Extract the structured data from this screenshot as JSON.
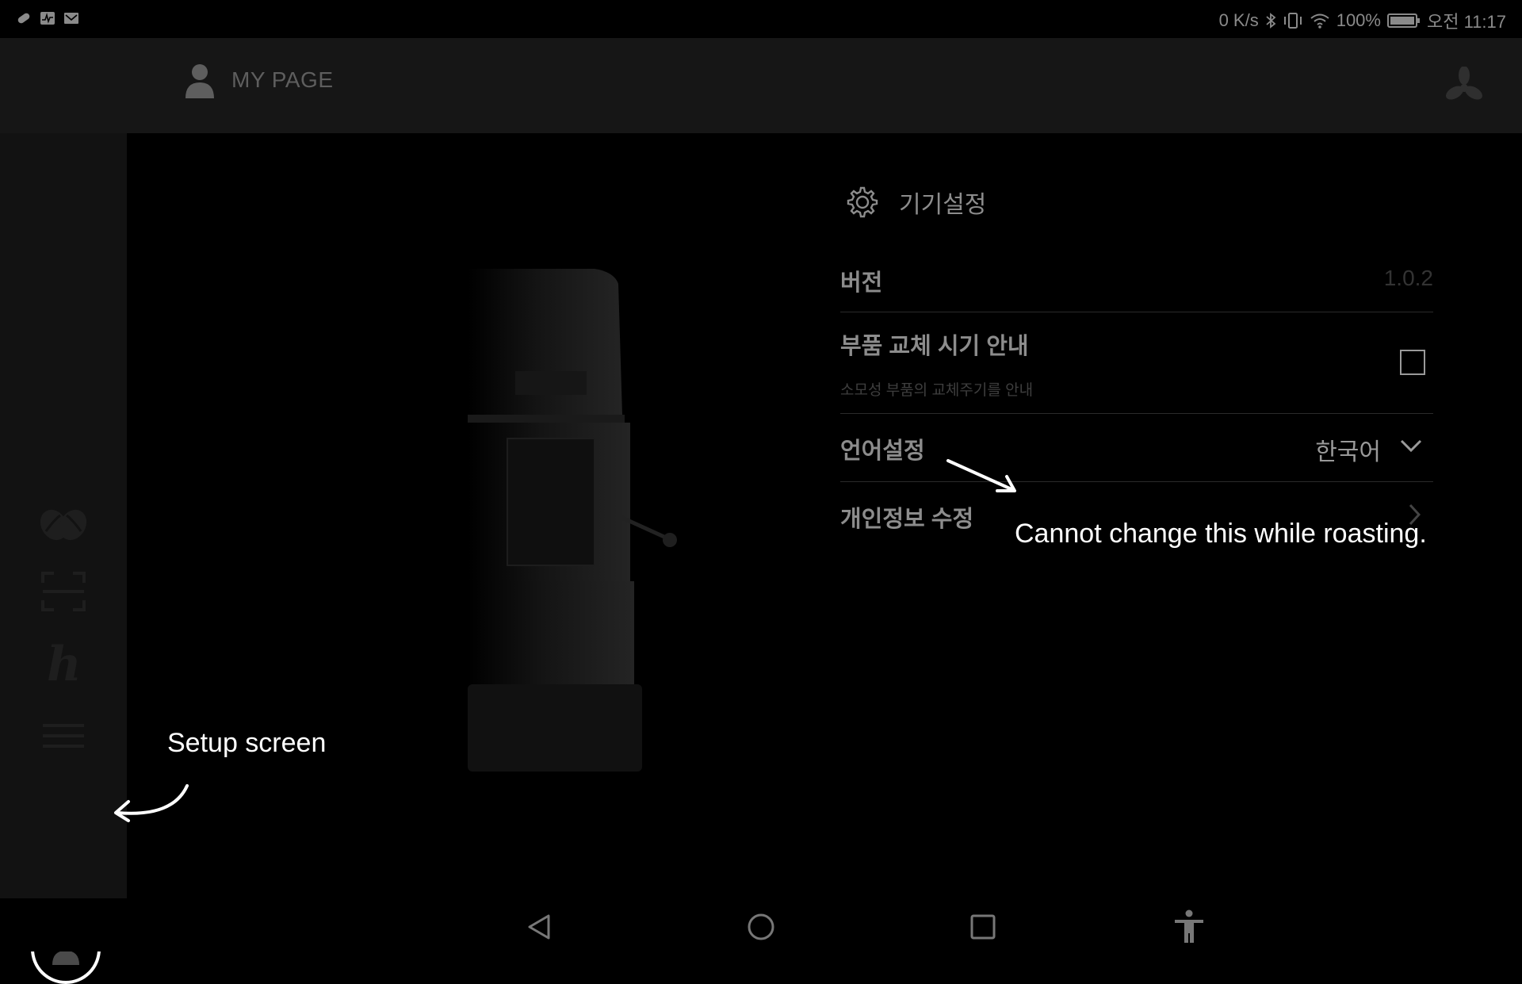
{
  "status_bar": {
    "network_speed": "0 K/s",
    "battery": "100%",
    "time": "오전 11:17",
    "left_icons": [
      "pill-icon",
      "activity-icon",
      "mail-icon"
    ],
    "right_icons": [
      "bluetooth-icon",
      "vibrate-icon",
      "wifi-icon",
      "battery-icon"
    ]
  },
  "header": {
    "title": "MY PAGE",
    "left_icon": "user-icon",
    "right_icon": "fan-icon"
  },
  "sidebar": {
    "items": [
      {
        "icon": "coffee-bean-icon"
      },
      {
        "icon": "scan-icon"
      },
      {
        "icon": "h-logo-icon"
      },
      {
        "icon": "menu-icon"
      },
      {
        "icon": "user-icon",
        "active": true
      }
    ]
  },
  "settings": {
    "title": "기기설정",
    "title_icon": "gear-icon",
    "rows": {
      "version": {
        "label": "버전",
        "value": "1.0.2"
      },
      "parts": {
        "label": "부품 교체 시기 안내",
        "sub": "소모성 부품의 교체주기를 안내",
        "checked": false
      },
      "language": {
        "label": "언어설정",
        "value": "한국어"
      },
      "profile": {
        "label": "개인정보 수정"
      }
    }
  },
  "annotations": {
    "setup": "Setup screen",
    "roasting": "Cannot change this while roasting."
  },
  "navbar": {
    "buttons": [
      "back-icon",
      "home-icon",
      "recents-icon",
      "accessibility-icon"
    ]
  },
  "colors": {
    "background": "#000000",
    "header": "#161616",
    "sidebar": "#121212",
    "muted_text": "#8c8c8c",
    "annotation": "#ffffff"
  }
}
